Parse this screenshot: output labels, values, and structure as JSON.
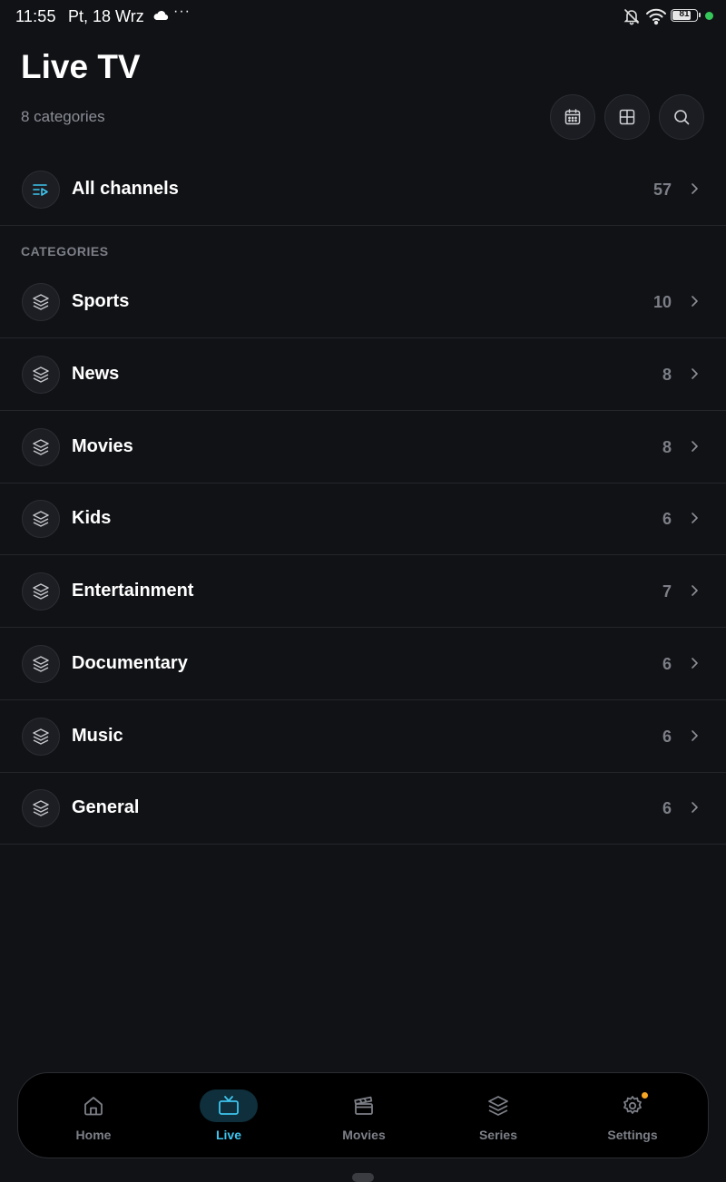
{
  "status_bar": {
    "time": "11:55",
    "date": "Pt, 18 Wrz",
    "more": "···",
    "battery": "81",
    "battery_level": 0.81
  },
  "header": {
    "title": "Live TV",
    "subtitle": "8 categories"
  },
  "header_actions": {
    "icons": [
      "calendar-icon",
      "grid-icon",
      "search-icon"
    ]
  },
  "all_channels": {
    "label": "All channels",
    "count": "57"
  },
  "categories_heading": "CATEGORIES",
  "categories": [
    {
      "label": "Sports",
      "count": "10"
    },
    {
      "label": "News",
      "count": "8"
    },
    {
      "label": "Movies",
      "count": "8"
    },
    {
      "label": "Kids",
      "count": "6"
    },
    {
      "label": "Entertainment",
      "count": "7"
    },
    {
      "label": "Documentary",
      "count": "6"
    },
    {
      "label": "Music",
      "count": "6"
    },
    {
      "label": "General",
      "count": "6"
    }
  ],
  "bottom_nav": [
    {
      "label": "Home",
      "icon": "home-icon",
      "active": false
    },
    {
      "label": "Live",
      "icon": "tv-icon",
      "active": true
    },
    {
      "label": "Movies",
      "icon": "clapperboard-icon",
      "active": false
    },
    {
      "label": "Series",
      "icon": "layers-icon",
      "active": false
    },
    {
      "label": "Settings",
      "icon": "gear-icon",
      "active": false
    }
  ],
  "colors": {
    "background": "#111216",
    "accent": "#3ec5ef",
    "muted_text": "#7c7f87",
    "notification_dot": "#f5a623",
    "status_dot": "#35c759"
  }
}
